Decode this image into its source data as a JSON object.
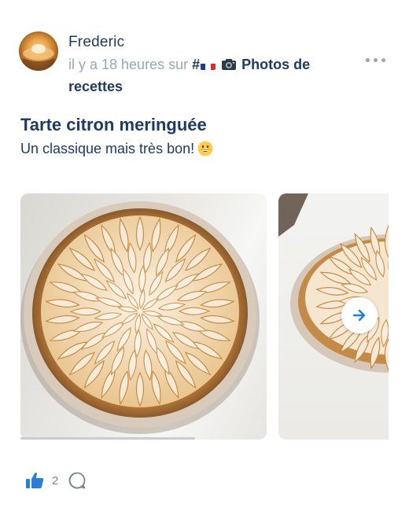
{
  "post": {
    "author": "Frederic",
    "time_text": "il y a 18 heures sur",
    "group_prefix": "#",
    "group_name": "Photos de recettes",
    "title": "Tarte citron meringuée",
    "description": "Un classique mais très bon!",
    "description_emoji": "grinning-face-emoji"
  },
  "actions": {
    "like_count": "2",
    "like_icon": "thumbs-up-icon",
    "comment_icon": "comment-bubble-icon"
  },
  "icons": {
    "more": "more-dots-icon",
    "next": "arrow-right-icon",
    "flag": "france-flag-icon",
    "camera": "camera-icon"
  },
  "colors": {
    "primary": "#1f3b63",
    "muted": "#9aa6b4",
    "accent": "#1e7fd9",
    "like": "#2a7fd4"
  }
}
